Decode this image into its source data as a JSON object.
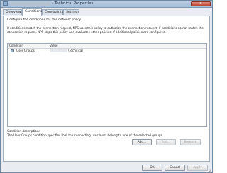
{
  "window": {
    "title": "- Technical Properties",
    "close_label": "✕"
  },
  "tabs": [
    {
      "label": "Overview"
    },
    {
      "label": "Conditions"
    },
    {
      "label": "Constraints"
    },
    {
      "label": "Settings"
    }
  ],
  "conditions_tab": {
    "intro": "Configure the conditions for this network policy.",
    "description": "If conditions match the connection request, NPS uses this policy to authorize the connection request. If conditions do not match the connection request, NPS skips this policy and evaluates other policies, if additional policies are configured.",
    "table": {
      "headers": [
        "Condition",
        "Value"
      ],
      "rows": [
        {
          "condition": "User Groups",
          "value": "\\Technical"
        }
      ]
    },
    "condition_description_label": "Condition description:",
    "condition_description_text": "The User Groups condition specifies that the connecting user must belong to one of the selected groups.",
    "buttons": {
      "add": "Add...",
      "edit": "Edit...",
      "remove": "Remove"
    }
  },
  "dialog_buttons": {
    "ok": "OK",
    "cancel": "Cancel",
    "apply": "Apply"
  }
}
